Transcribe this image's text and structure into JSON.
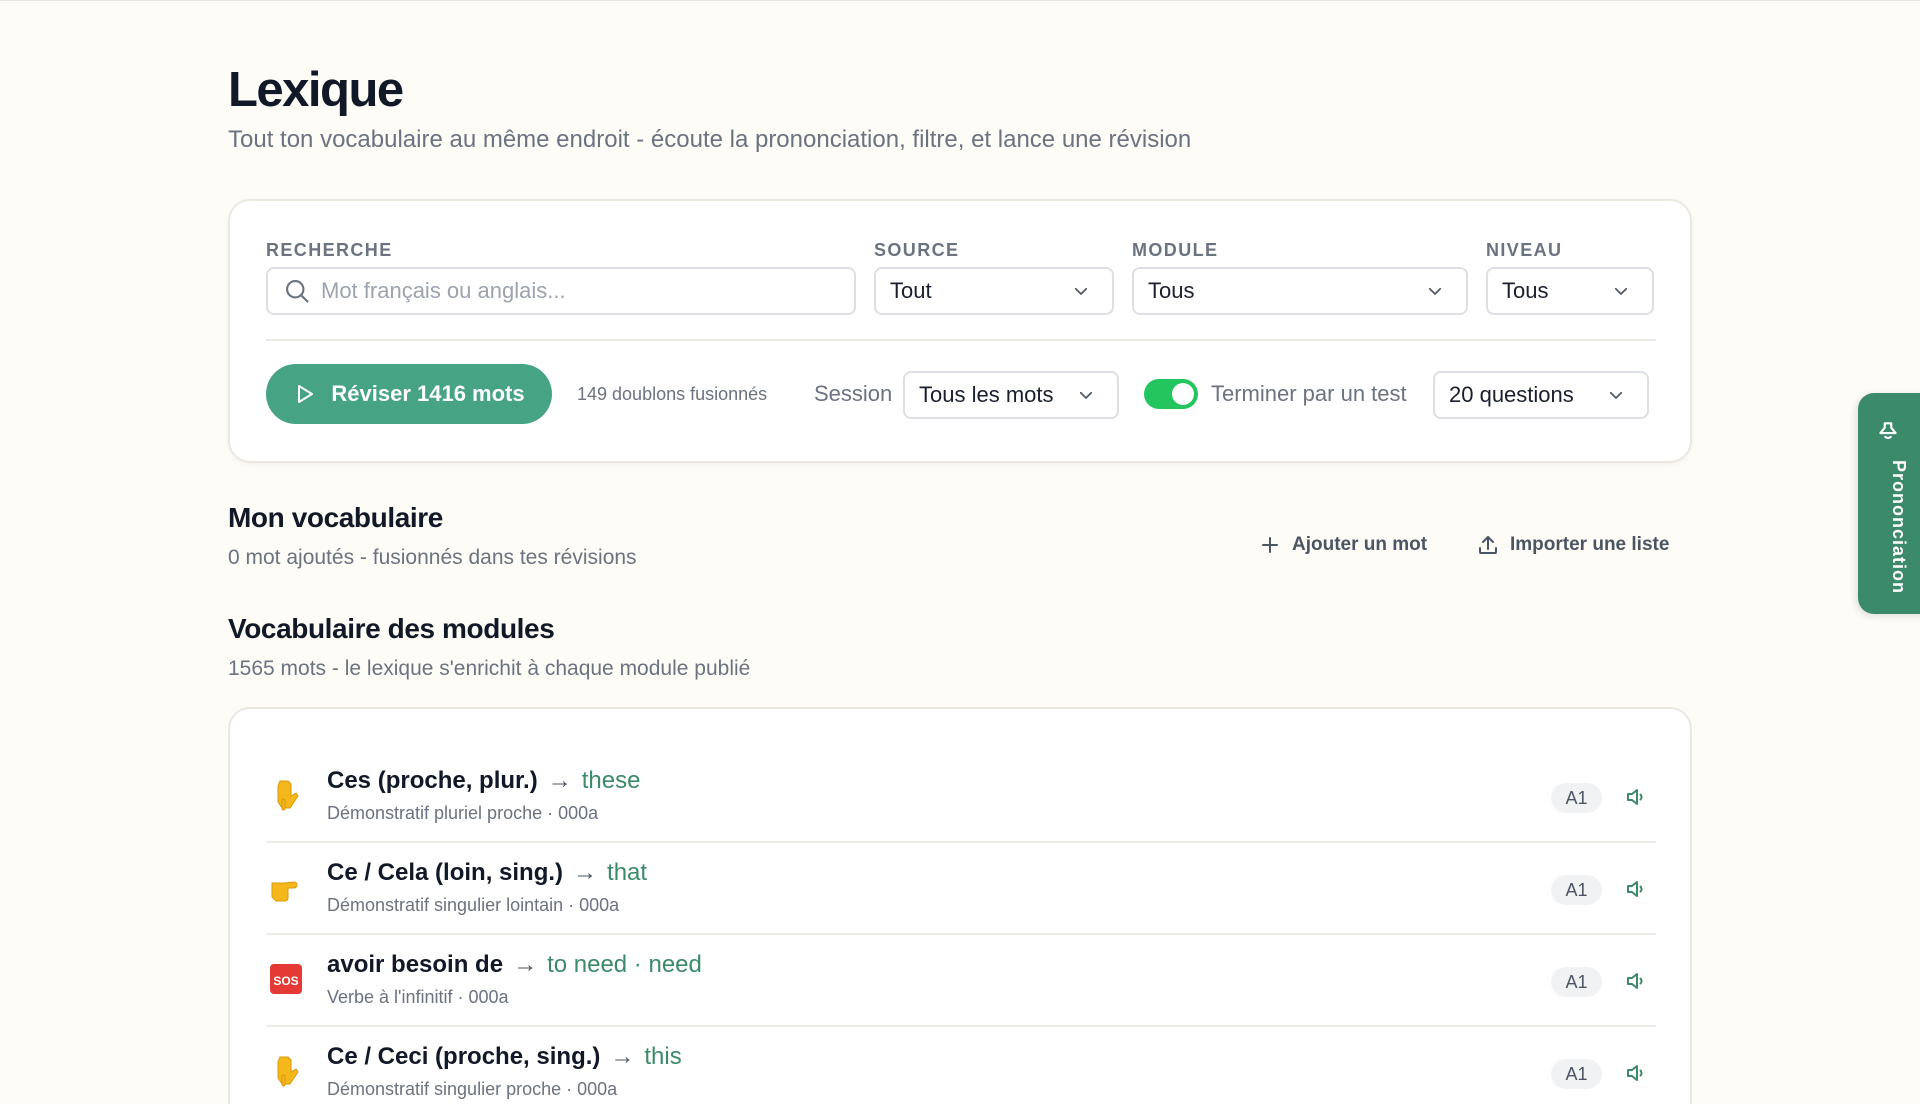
{
  "page": {
    "title": "Lexique",
    "subtitle": "Tout ton vocabulaire au même endroit - écoute la prononciation, filtre, et lance une révision"
  },
  "filters": {
    "search": {
      "label": "RECHERCHE",
      "placeholder": "Mot français ou anglais...",
      "value": ""
    },
    "source": {
      "label": "SOURCE",
      "value": "Tout"
    },
    "module": {
      "label": "MODULE",
      "value": "Tous"
    },
    "level": {
      "label": "NIVEAU",
      "value": "Tous"
    }
  },
  "review": {
    "button_label": "Réviser 1416 mots",
    "merged_text": "149 doublons fusionnés",
    "session_label": "Session",
    "session_value": "Tous les mots",
    "test_toggle_on": true,
    "test_label": "Terminer par un test",
    "questions_value": "20 questions"
  },
  "my_vocab": {
    "title": "Mon vocabulaire",
    "subtitle": "0 mot ajoutés - fusionnés dans tes révisions",
    "add_label": "Ajouter un mot",
    "import_label": "Importer une liste"
  },
  "module_vocab": {
    "title": "Vocabulaire des modules",
    "subtitle": "1565 mots - le lexique s'enrichit à chaque module publié",
    "words": [
      {
        "icon": "pointing-down-icon",
        "fr": "Ces (proche, plur.)",
        "arrow": "→",
        "en": "these",
        "meta": "Démonstratif pluriel proche · 000a",
        "level": "A1"
      },
      {
        "icon": "pointing-right-icon",
        "fr": "Ce / Cela (loin, sing.)",
        "arrow": "→",
        "en": "that",
        "meta": "Démonstratif singulier lointain · 000a",
        "level": "A1"
      },
      {
        "icon": "sos-icon",
        "fr": "avoir besoin de",
        "arrow": "→",
        "en": "to need · need",
        "meta": "Verbe à l'infinitif · 000a",
        "level": "A1"
      },
      {
        "icon": "pointing-down-icon",
        "fr": "Ce / Ceci (proche, sing.)",
        "arrow": "→",
        "en": "this",
        "meta": "Démonstratif singulier proche · 000a",
        "level": "A1"
      }
    ]
  },
  "side_tab": {
    "label": "Prononciation"
  },
  "colors": {
    "accent": "#46a383",
    "accent_dark": "#3b8b6b",
    "toggle_on": "#22c55e",
    "background": "#fefcf7"
  }
}
